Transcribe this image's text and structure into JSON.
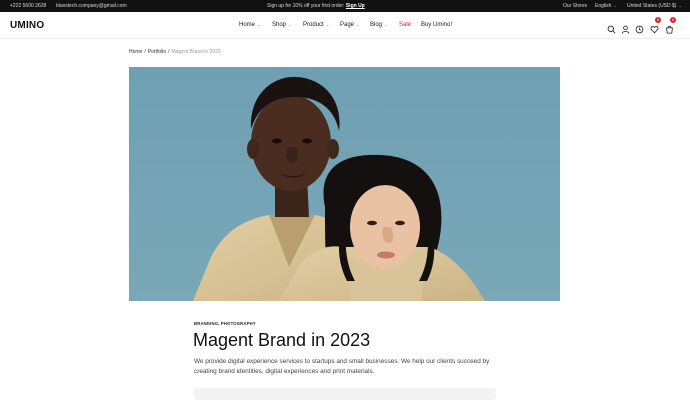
{
  "topbar": {
    "phone": "+222 5600 2628",
    "email": "blaxstech.company@gmail.com",
    "promo_text": "Sign up for 10% off your first order:",
    "promo_link": "Sign Up",
    "stores": "Our Stores",
    "language": "English",
    "currency": "United States (USD $)"
  },
  "header": {
    "logo": "UMINO",
    "nav": [
      {
        "label": "Home",
        "dropdown": true
      },
      {
        "label": "Shop",
        "dropdown": true
      },
      {
        "label": "Product",
        "dropdown": true
      },
      {
        "label": "Page",
        "dropdown": true
      },
      {
        "label": "Blog",
        "dropdown": true
      },
      {
        "label": "Sale",
        "dropdown": false
      },
      {
        "label": "Buy Umino!",
        "dropdown": false
      }
    ],
    "wishlist_count": "0",
    "cart_count": "0"
  },
  "breadcrumb": {
    "home": "Home",
    "section": "Portfolio",
    "current": "Magent Brand in 2023"
  },
  "project": {
    "tags": "BRANDING, PHOTOGRAPHY",
    "title": "Magent Brand in 2023",
    "description": "We provide digital experience services to startups and small businesses. We help our clients succeed by creating brand identities, digital experiences and print materials."
  },
  "colors": {
    "topbar_bg": "#111111",
    "sale": "#d0252b",
    "hero_bg": "#72a1b3"
  }
}
